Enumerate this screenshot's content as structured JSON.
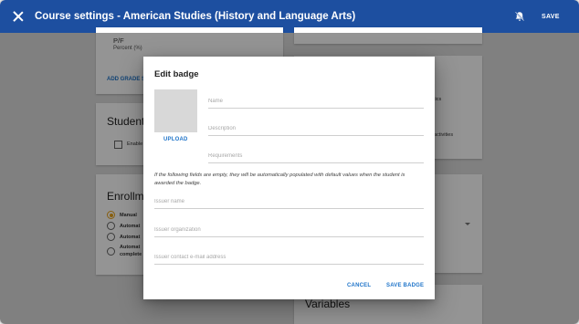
{
  "appbar": {
    "title": "Course settings - American Studies (History and Language Arts)",
    "close_icon": "close-icon",
    "notification_icon": "bell-off-icon",
    "save_label": "SAVE"
  },
  "background": {
    "grading": {
      "scale_name": "P/F",
      "scale_type": "Percent (%)",
      "add_grade_label": "ADD GRADE S"
    },
    "student_section": {
      "heading": "Student",
      "checkbox_label": "Enable"
    },
    "enrollment_section": {
      "heading": "Enrollm",
      "options": [
        {
          "label": "Manual",
          "selected": true
        },
        {
          "label": "Automat",
          "selected": false
        },
        {
          "label": "Automat",
          "selected": false
        },
        {
          "label": "Automat\ncomplete",
          "selected": false
        }
      ]
    },
    "right_column": {
      "text_1": "tics",
      "text_2": "activities",
      "variables_heading": "Variables"
    },
    "accent_color": "#e8a21a"
  },
  "dialog": {
    "title": "Edit badge",
    "upload_label": "UPLOAD",
    "name_placeholder": "Name",
    "description_placeholder": "Description",
    "requirements_placeholder": "Requirements",
    "note": "If the following fields are empty, they will be automatically populated with default values when the student is awarded the badge.",
    "issuer_name_placeholder": "Issuer name",
    "issuer_org_placeholder": "Issuer organization",
    "issuer_email_placeholder": "Issuer contact e-mail address",
    "cancel_label": "CANCEL",
    "save_badge_label": "SAVE BADGE"
  },
  "colors": {
    "appbar": "#1d4fa0",
    "link": "#1f74c9"
  }
}
